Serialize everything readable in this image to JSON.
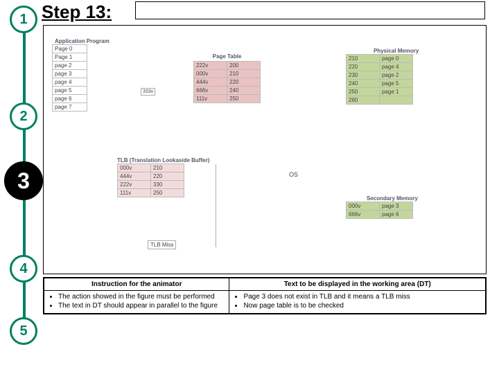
{
  "step_title": "Step 13:",
  "stepper": [
    "1",
    "2",
    "3",
    "4",
    "5"
  ],
  "diagram": {
    "app_program": {
      "label": "Application Program",
      "rows": [
        "Page 0",
        "Page 1",
        "page 2",
        "page 3",
        "page 4",
        "page 5",
        "page 6",
        "page 7"
      ],
      "side": "333v"
    },
    "page_table": {
      "label": "Page Table",
      "rows": [
        [
          "222v",
          "200"
        ],
        [
          "000v",
          "210"
        ],
        [
          "444v",
          "220"
        ],
        [
          "666v",
          "240"
        ],
        [
          "111v",
          "250"
        ]
      ]
    },
    "physical_memory": {
      "label": "Physical Memory",
      "rows": [
        [
          "210",
          "page 0"
        ],
        [
          "220",
          "page 4"
        ],
        [
          "230",
          "page 2"
        ],
        [
          "240",
          "page 5"
        ],
        [
          "250",
          "page 1"
        ],
        [
          "260",
          ""
        ]
      ]
    },
    "tlb": {
      "label": "TLB (Translation Lookaside Buffer)",
      "rows": [
        [
          "000v",
          "210"
        ],
        [
          "444v",
          "220"
        ],
        [
          "222v",
          "330"
        ],
        [
          "111v",
          "250"
        ]
      ],
      "miss": "TLB Miss"
    },
    "os": "OS",
    "secondary_memory": {
      "label": "Secondary Memory",
      "rows": [
        [
          "000v",
          "page 3"
        ],
        [
          "666v",
          "page 6"
        ]
      ]
    }
  },
  "instruction_table": {
    "left_header": "Instruction for the animator",
    "right_header": "Text to be displayed in the working area (DT)",
    "left_bullets": [
      "The action showed in the figure must be performed",
      "The text in DT should appear  in parallel to the figure"
    ],
    "right_bullets": [
      "Page 3 does not exist in TLB and it means a TLB miss",
      "Now page table is to be checked"
    ]
  }
}
